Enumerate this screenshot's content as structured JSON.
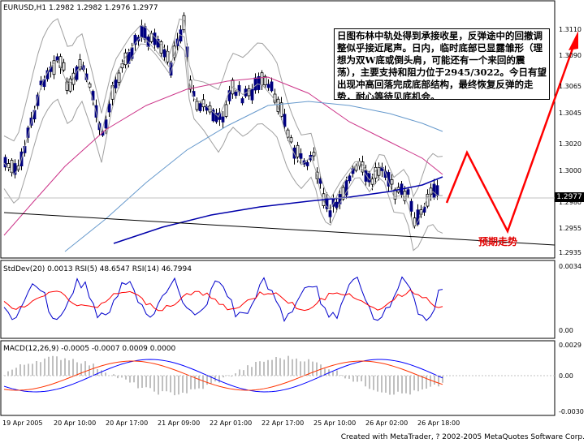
{
  "header": {
    "symbol": "EURUSD,H1",
    "ohlc": "1.2982 1.2982 1.2976 1.2977"
  },
  "annotation_text": "日图布林中轨处得到承接收星，反弹途中的回撤调整似乎接近尾声。日内，临时底部已显露雏形（理想为双W底或倒头肩，可能还有一个来回的震荡），主要支持和阻力位于2945/3022。今日有望出现冲高回落完成底部结构，最终恢复反弹的走势，耐心等待见底机会。",
  "expected_label": "预期走势",
  "current_price": "1.2977",
  "price_scale": [
    "1.3110",
    "1.3090",
    "1.3065",
    "1.3045",
    "1.3020",
    "1.3000",
    "1.2980",
    "1.2955",
    "1.2935"
  ],
  "panels": {
    "stddev_rsi": {
      "label": "StdDev(20) 0.0013  RSI(5) 48.6547  RSI(14) 46.7994",
      "scale": [
        "0.0034",
        "0.00"
      ]
    },
    "macd": {
      "label": "MACD(12,26,9) -0.0005 -0.0007 0.0009 0.0000",
      "scale": [
        "0.0029",
        "0.00",
        "-0.0030"
      ]
    }
  },
  "time_axis": [
    "19 Apr 2005",
    "20 Apr 10:00",
    "20 Apr 17:00",
    "21 Apr 09:00",
    "22 Apr 01:00",
    "22 Apr 17:00",
    "25 Apr 10:00",
    "26 Apr 02:00",
    "26 Apr 18:00"
  ],
  "footer": "Created with MetaTrader, ? 2002-2005 MetaQuotes Software Corp.",
  "colors": {
    "bull_candle": "#000000",
    "bear_candle": "#000080",
    "bollinger": "#a0a0a0",
    "ma_fast": "#cc3388",
    "ma_slow": "#6699cc",
    "ma_long": "#0000aa",
    "trendline": "#000000",
    "expected_path": "#ff0000",
    "rsi_fast": "#0000cc",
    "rsi_slow": "#ff0000",
    "macd_line": "#0000ff",
    "signal_line": "#ff3300",
    "histogram": "#808080"
  }
}
